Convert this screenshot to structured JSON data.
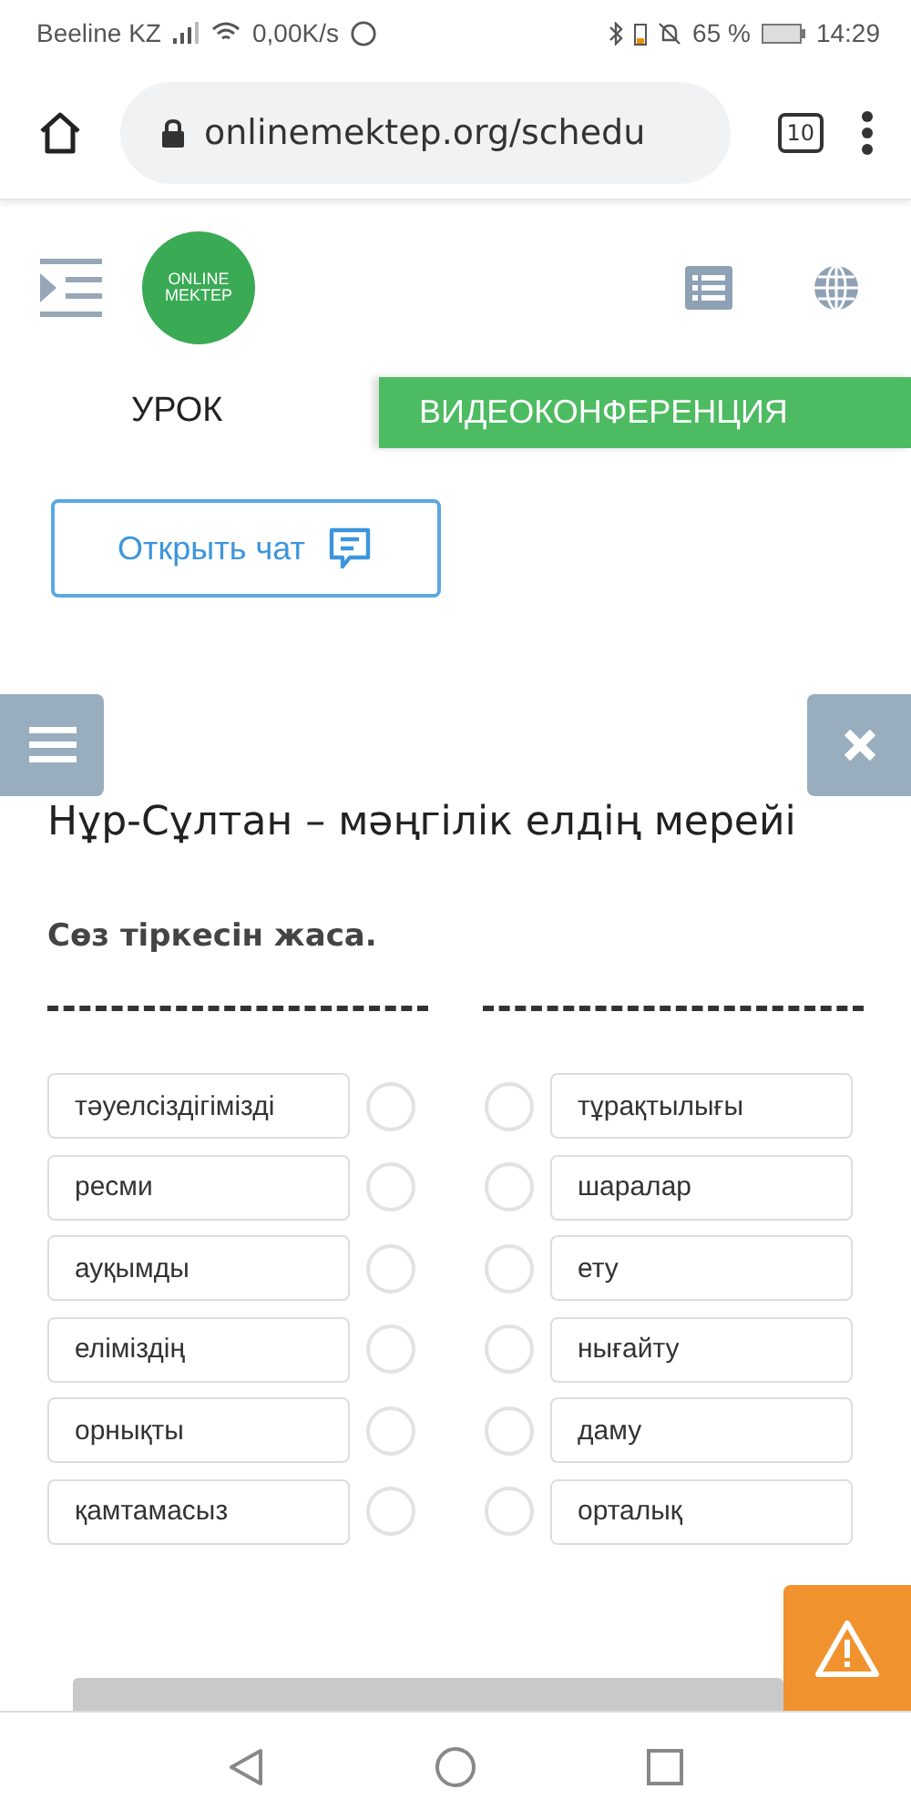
{
  "status_bar": {
    "carrier": "Beeline KZ",
    "speed": "0,00K/s",
    "battery": "65 %",
    "time": "14:29"
  },
  "browser": {
    "url": "onlinemektep.org/schedu",
    "tab_count": "10"
  },
  "header": {
    "logo": [
      "ONLINE",
      "MEKTEP"
    ]
  },
  "tabs": [
    {
      "label": "УРОК",
      "selected": false
    },
    {
      "label": "ВИДЕОКОНФЕРЕНЦИЯ",
      "selected": true
    }
  ],
  "chat_button": "Открыть чат",
  "title": "Нұр-Сұлтан – мәңгілік елдің мерейі",
  "instruction": "Сөз тіркесін жаса.",
  "left": [
    {
      "text": "тәуелсіздігімізді",
      "selected": false
    },
    {
      "text": "ресми",
      "selected": false
    },
    {
      "text": "ауқымды",
      "selected": false
    },
    {
      "text": "еліміздің",
      "selected": false
    },
    {
      "text": "орнықты",
      "selected": false
    },
    {
      "text": "қамтамасыз",
      "selected": false
    }
  ],
  "right": [
    {
      "text": "тұрақтылығы",
      "selected": false
    },
    {
      "text": "шаралар",
      "selected": false
    },
    {
      "text": "ету",
      "selected": false
    },
    {
      "text": "нығайту",
      "selected": false
    },
    {
      "text": "даму",
      "selected": false
    },
    {
      "text": "орталық",
      "selected": false
    }
  ]
}
